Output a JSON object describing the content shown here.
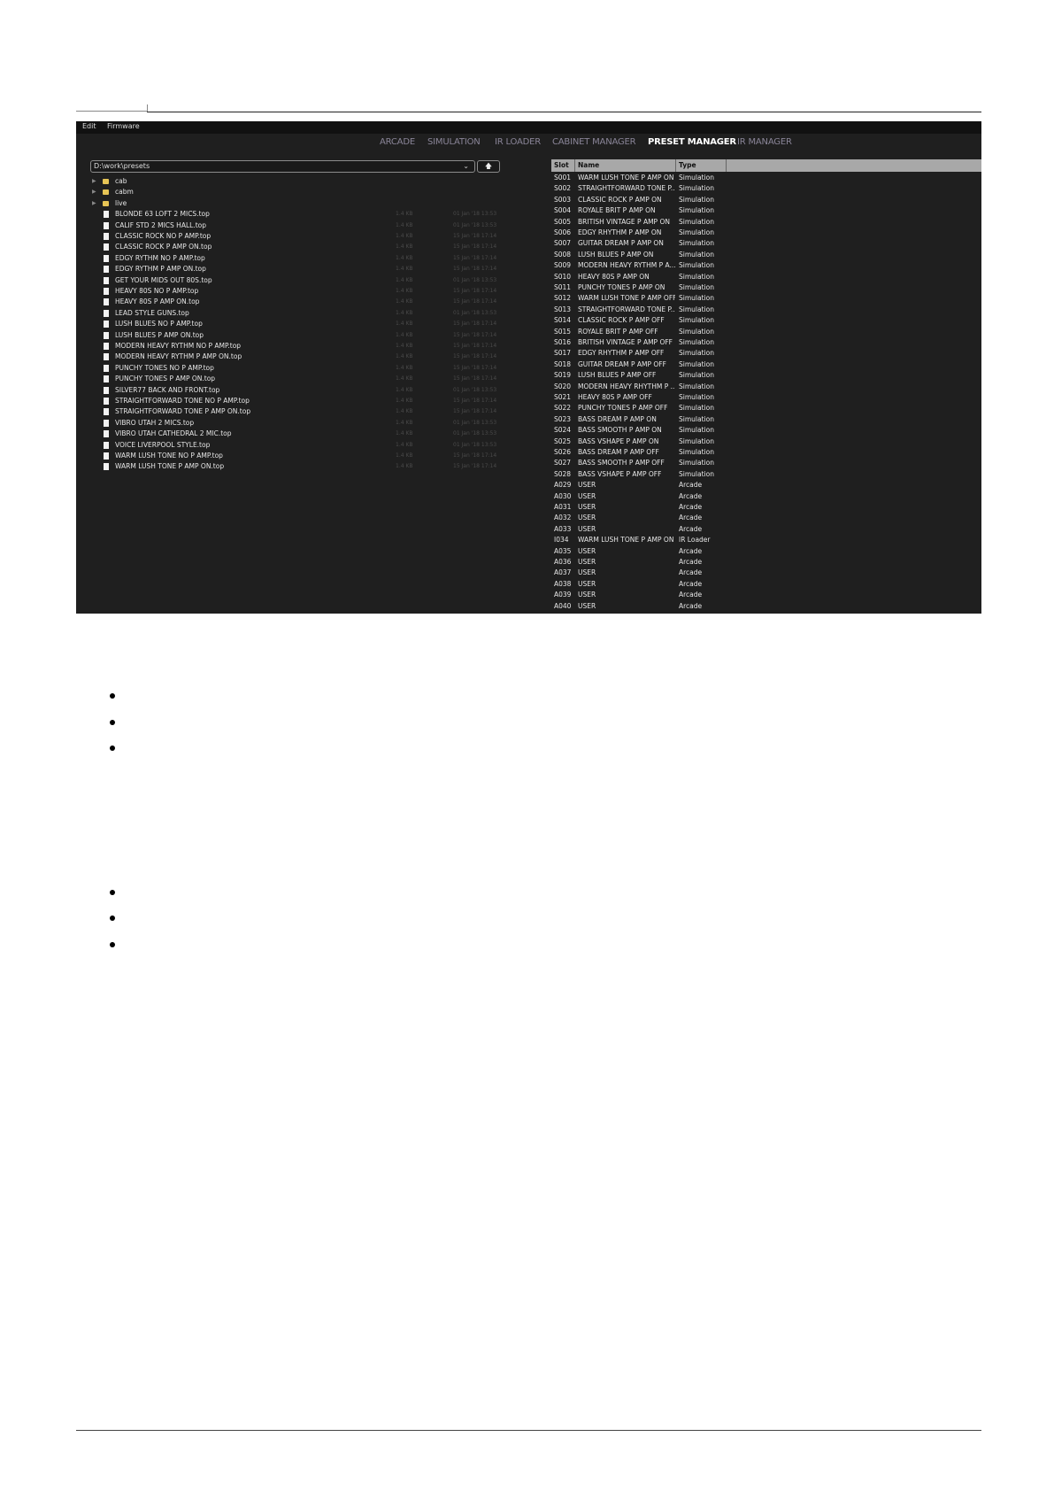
{
  "menu": {
    "edit": "Edit",
    "firmware": "Firmware"
  },
  "tabs": [
    {
      "label": "ARCADE",
      "active": false
    },
    {
      "label": "SIMULATION",
      "active": false
    },
    {
      "label": "IR LOADER",
      "active": false
    },
    {
      "label": "CABINET MANAGER",
      "active": false
    },
    {
      "label": "PRESET MANAGER",
      "active": true
    },
    {
      "label": "IR MANAGER",
      "active": false
    }
  ],
  "path": {
    "value": "D:\\work\\presets",
    "chevron": "⌄",
    "up": "🡅"
  },
  "folders": [
    {
      "name": "cab"
    },
    {
      "name": "cabm"
    },
    {
      "name": "live"
    }
  ],
  "files": [
    {
      "name": "BLONDE 63 LOFT 2 MICS.top",
      "size": "1.4 KB",
      "date": "01 Jan '18 13:53"
    },
    {
      "name": "CALIF STD 2 MICS HALL.top",
      "size": "1.4 KB",
      "date": "01 Jan '18 13:53"
    },
    {
      "name": "CLASSIC ROCK NO P AMP.top",
      "size": "1.4 KB",
      "date": "15 Jan '18 17:14"
    },
    {
      "name": "CLASSIC ROCK P AMP ON.top",
      "size": "1.4 KB",
      "date": "15 Jan '18 17:14"
    },
    {
      "name": "EDGY RYTHM NO P AMP.top",
      "size": "1.4 KB",
      "date": "15 Jan '18 17:14"
    },
    {
      "name": "EDGY RYTHM P AMP ON.top",
      "size": "1.4 KB",
      "date": "15 Jan '18 17:14"
    },
    {
      "name": "GET YOUR MIDS OUT 80S.top",
      "size": "1.4 KB",
      "date": "01 Jan '18 13:53"
    },
    {
      "name": "HEAVY 80S NO P AMP.top",
      "size": "1.4 KB",
      "date": "15 Jan '18 17:14"
    },
    {
      "name": "HEAVY 80S P AMP ON.top",
      "size": "1.4 KB",
      "date": "15 Jan '18 17:14"
    },
    {
      "name": "LEAD STYLE GUNS.top",
      "size": "1.4 KB",
      "date": "01 Jan '18 13:53"
    },
    {
      "name": "LUSH BLUES NO P AMP.top",
      "size": "1.4 KB",
      "date": "15 Jan '18 17:14"
    },
    {
      "name": "LUSH BLUES P AMP ON.top",
      "size": "1.4 KB",
      "date": "15 Jan '18 17:14"
    },
    {
      "name": "MODERN HEAVY RYTHM NO P AMP.top",
      "size": "1.4 KB",
      "date": "15 Jan '18 17:14"
    },
    {
      "name": "MODERN HEAVY RYTHM P AMP ON.top",
      "size": "1.4 KB",
      "date": "15 Jan '18 17:14"
    },
    {
      "name": "PUNCHY TONES NO P AMP.top",
      "size": "1.4 KB",
      "date": "15 Jan '18 17:14"
    },
    {
      "name": "PUNCHY TONES P AMP ON.top",
      "size": "1.4 KB",
      "date": "15 Jan '18 17:14"
    },
    {
      "name": "SILVER77 BACK AND FRONT.top",
      "size": "1.4 KB",
      "date": "01 Jan '18 13:53"
    },
    {
      "name": "STRAIGHTFORWARD TONE NO P AMP.top",
      "size": "1.4 KB",
      "date": "15 Jan '18 17:14"
    },
    {
      "name": "STRAIGHTFORWARD TONE P AMP ON.top",
      "size": "1.4 KB",
      "date": "15 Jan '18 17:14"
    },
    {
      "name": "VIBRO UTAH 2 MICS.top",
      "size": "1.4 KB",
      "date": "01 Jan '18 13:53"
    },
    {
      "name": "VIBRO UTAH CATHEDRAL 2 MIC.top",
      "size": "1.4 KB",
      "date": "01 Jan '18 13:53"
    },
    {
      "name": "VOICE LIVERPOOL STYLE.top",
      "size": "1.4 KB",
      "date": "01 Jan '18 13:53"
    },
    {
      "name": "WARM LUSH TONE NO P AMP.top",
      "size": "1.4 KB",
      "date": "15 Jan '18 17:14"
    },
    {
      "name": "WARM LUSH TONE P AMP ON.top",
      "size": "1.4 KB",
      "date": "15 Jan '18 17:14"
    }
  ],
  "table": {
    "headers": {
      "slot": "Slot",
      "name": "Name",
      "type": "Type"
    },
    "rows": [
      {
        "slot": "S001",
        "name": "WARM LUSH TONE P AMP ON",
        "type": "Simulation"
      },
      {
        "slot": "S002",
        "name": "STRAIGHTFORWARD TONE P...",
        "type": "Simulation"
      },
      {
        "slot": "S003",
        "name": "CLASSIC ROCK P AMP ON",
        "type": "Simulation"
      },
      {
        "slot": "S004",
        "name": "ROYALE BRIT P AMP ON",
        "type": "Simulation"
      },
      {
        "slot": "S005",
        "name": "BRITISH VINTAGE P AMP ON",
        "type": "Simulation"
      },
      {
        "slot": "S006",
        "name": "EDGY RHYTHM P AMP ON",
        "type": "Simulation"
      },
      {
        "slot": "S007",
        "name": "GUITAR DREAM P AMP ON",
        "type": "Simulation"
      },
      {
        "slot": "S008",
        "name": "LUSH BLUES P AMP ON",
        "type": "Simulation"
      },
      {
        "slot": "S009",
        "name": "MODERN HEAVY RYTHM P A...",
        "type": "Simulation"
      },
      {
        "slot": "S010",
        "name": "HEAVY 80S P AMP ON",
        "type": "Simulation"
      },
      {
        "slot": "S011",
        "name": "PUNCHY TONES P AMP ON",
        "type": "Simulation"
      },
      {
        "slot": "S012",
        "name": "WARM LUSH TONE P AMP OFF",
        "type": "Simulation"
      },
      {
        "slot": "S013",
        "name": "STRAIGHTFORWARD TONE P...",
        "type": "Simulation"
      },
      {
        "slot": "S014",
        "name": "CLASSIC ROCK P AMP OFF",
        "type": "Simulation"
      },
      {
        "slot": "S015",
        "name": "ROYALE BRIT P AMP OFF",
        "type": "Simulation"
      },
      {
        "slot": "S016",
        "name": "BRITISH VINTAGE P AMP OFF",
        "type": "Simulation"
      },
      {
        "slot": "S017",
        "name": "EDGY RHYTHM P AMP OFF",
        "type": "Simulation"
      },
      {
        "slot": "S018",
        "name": "GUITAR DREAM P AMP OFF",
        "type": "Simulation"
      },
      {
        "slot": "S019",
        "name": "LUSH BLUES P AMP OFF",
        "type": "Simulation"
      },
      {
        "slot": "S020",
        "name": "MODERN HEAVY RHYTHM P ...",
        "type": "Simulation"
      },
      {
        "slot": "S021",
        "name": "HEAVY 80S P AMP OFF",
        "type": "Simulation"
      },
      {
        "slot": "S022",
        "name": "PUNCHY TONES P AMP OFF",
        "type": "Simulation"
      },
      {
        "slot": "S023",
        "name": "BASS DREAM P AMP ON",
        "type": "Simulation"
      },
      {
        "slot": "S024",
        "name": "BASS SMOOTH P AMP ON",
        "type": "Simulation"
      },
      {
        "slot": "S025",
        "name": "BASS VSHAPE P AMP ON",
        "type": "Simulation"
      },
      {
        "slot": "S026",
        "name": "BASS DREAM P AMP OFF",
        "type": "Simulation"
      },
      {
        "slot": "S027",
        "name": "BASS SMOOTH P AMP OFF",
        "type": "Simulation"
      },
      {
        "slot": "S028",
        "name": "BASS VSHAPE P AMP OFF",
        "type": "Simulation"
      },
      {
        "slot": "A029",
        "name": "USER",
        "type": "Arcade"
      },
      {
        "slot": "A030",
        "name": "USER",
        "type": "Arcade"
      },
      {
        "slot": "A031",
        "name": "USER",
        "type": "Arcade"
      },
      {
        "slot": "A032",
        "name": "USER",
        "type": "Arcade"
      },
      {
        "slot": "A033",
        "name": "USER",
        "type": "Arcade"
      },
      {
        "slot": "I034",
        "name": "WARM LUSH TONE P AMP ON",
        "type": "IR Loader"
      },
      {
        "slot": "A035",
        "name": "USER",
        "type": "Arcade"
      },
      {
        "slot": "A036",
        "name": "USER",
        "type": "Arcade"
      },
      {
        "slot": "A037",
        "name": "USER",
        "type": "Arcade"
      },
      {
        "slot": "A038",
        "name": "USER",
        "type": "Arcade"
      },
      {
        "slot": "A039",
        "name": "USER",
        "type": "Arcade"
      },
      {
        "slot": "A040",
        "name": "USER",
        "type": "Arcade"
      }
    ]
  },
  "colors": {
    "app_bg": "#1f1f1f",
    "active_tab": "#ffffff",
    "inactive_tab": "#8a8598",
    "folder": "#e6c455",
    "header_bg": "#a8a8a8"
  }
}
